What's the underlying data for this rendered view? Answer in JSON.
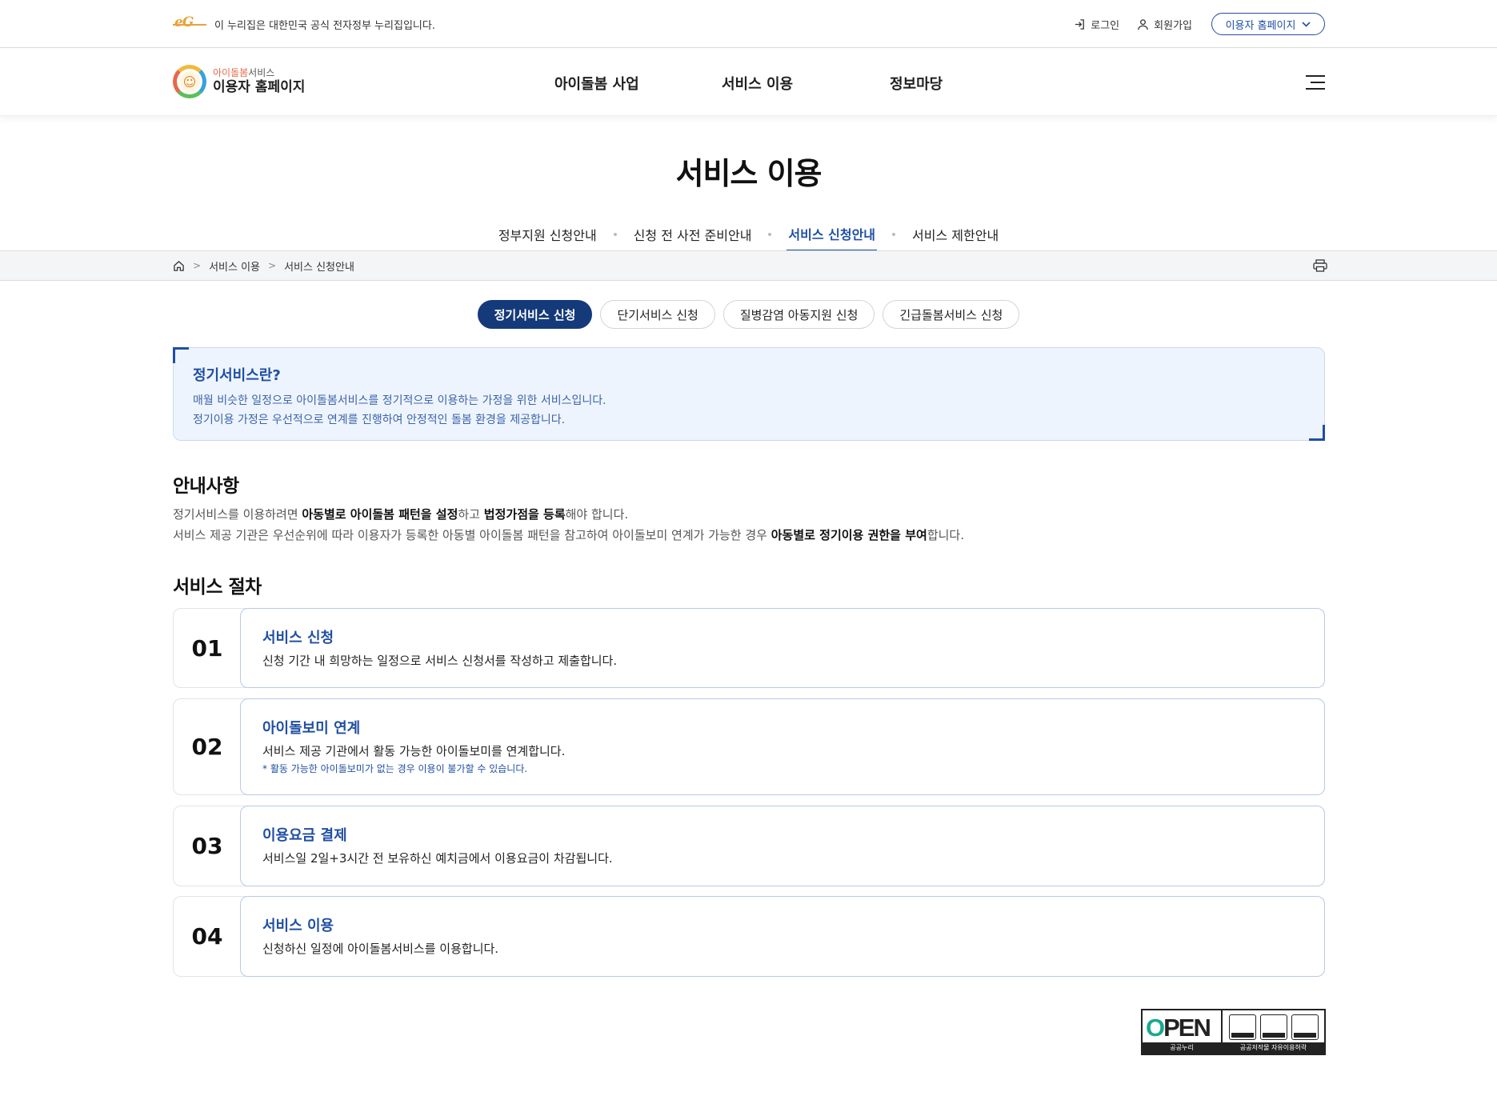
{
  "gov_bar": {
    "text": "이 누리집은 대한민국 공식 전자정부 누리집입니다.",
    "login": "로그인",
    "signup": "회원가입",
    "site_select": "이용자 홈페이지"
  },
  "header": {
    "logo_small_accent": "아이돌봄",
    "logo_small_rest": "서비스",
    "logo_big": "이용자 홈페이지",
    "nav": [
      "아이돌봄 사업",
      "서비스 이용",
      "정보마당"
    ]
  },
  "page_title": "서비스 이용",
  "sub_tabs": [
    "정부지원 신청안내",
    "신청 전 사전 준비안내",
    "서비스 신청안내",
    "서비스 제한안내"
  ],
  "sub_tabs_active": "서비스 신청안내",
  "breadcrumb": [
    "서비스 이용",
    "서비스 신청안내"
  ],
  "pill_tabs": [
    "정기서비스 신청",
    "단기서비스 신청",
    "질병감염 아동지원 신청",
    "긴급돌봄서비스 신청"
  ],
  "pill_tabs_active": "정기서비스 신청",
  "info_box": {
    "title": "정기서비스란?",
    "line1": "매월 비슷한 일정으로 아이돌봄서비스를 정기적으로 이용하는 가정을 위한 서비스입니다.",
    "line2": "정기이용 가정은 우선적으로 연계를 진행하여 안정적인 돌봄 환경을 제공합니다."
  },
  "notice": {
    "heading": "안내사항",
    "l1_a": "정기서비스를 이용하려면 ",
    "l1_b": "아동별로 아이돌봄 패턴을 설정",
    "l1_c": "하고 ",
    "l1_d": "법정가점을 등록",
    "l1_e": "해야 합니다.",
    "l2_a": "서비스 제공 기관은 우선순위에 따라 이용자가 등록한 아동별 아이돌봄 패턴을 참고하여 아이돌보미 연계가 가능한 경우 ",
    "l2_b": "아동별로 정기이용 권한을 부여",
    "l2_c": "합니다."
  },
  "procedure": {
    "heading": "서비스 절차",
    "steps": [
      {
        "num": "01",
        "title": "서비스 신청",
        "desc": "신청 기간 내 희망하는 일정으로 서비스 신청서를 작성하고 제출합니다.",
        "note": ""
      },
      {
        "num": "02",
        "title": "아이돌보미 연계",
        "desc": "서비스 제공 기관에서 활동 가능한 아이돌보미를 연계합니다.",
        "note": "* 활동 가능한 아이돌보미가 없는 경우 이용이 불가할 수 있습니다."
      },
      {
        "num": "03",
        "title": "이용요금 결제",
        "desc": "서비스일 2일+3시간 전 보유하신 예치금에서 이용요금이 차감됩니다.",
        "note": ""
      },
      {
        "num": "04",
        "title": "서비스 이용",
        "desc": "신청하신 일정에 아이돌봄서비스를 이용합니다.",
        "note": ""
      }
    ]
  },
  "license": {
    "open_a": "O",
    "open_b": "PEN",
    "open_label": "공공누리",
    "marks_label": "공공저작물 자유이용허락",
    "icons": [
      "attribution-icon",
      "noncommercial-icon",
      "no-derivatives-icon"
    ]
  }
}
